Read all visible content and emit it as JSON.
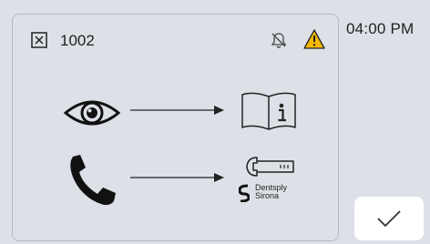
{
  "header": {
    "code": "1002",
    "time": "04:00 PM"
  },
  "brand": {
    "line1": "Dentsply",
    "line2": "Sirona"
  },
  "icons": {
    "close": "close-icon",
    "bell_off": "bell-off-icon",
    "warning": "warning-icon",
    "eye": "eye-icon",
    "manual": "manual-info-icon",
    "phone": "phone-icon",
    "wrench": "wrench-icon",
    "confirm": "checkmark-icon"
  },
  "colors": {
    "background": "#dde0e7",
    "warning_fill": "#f5b800",
    "text": "#222222",
    "button_bg": "#ffffff"
  }
}
